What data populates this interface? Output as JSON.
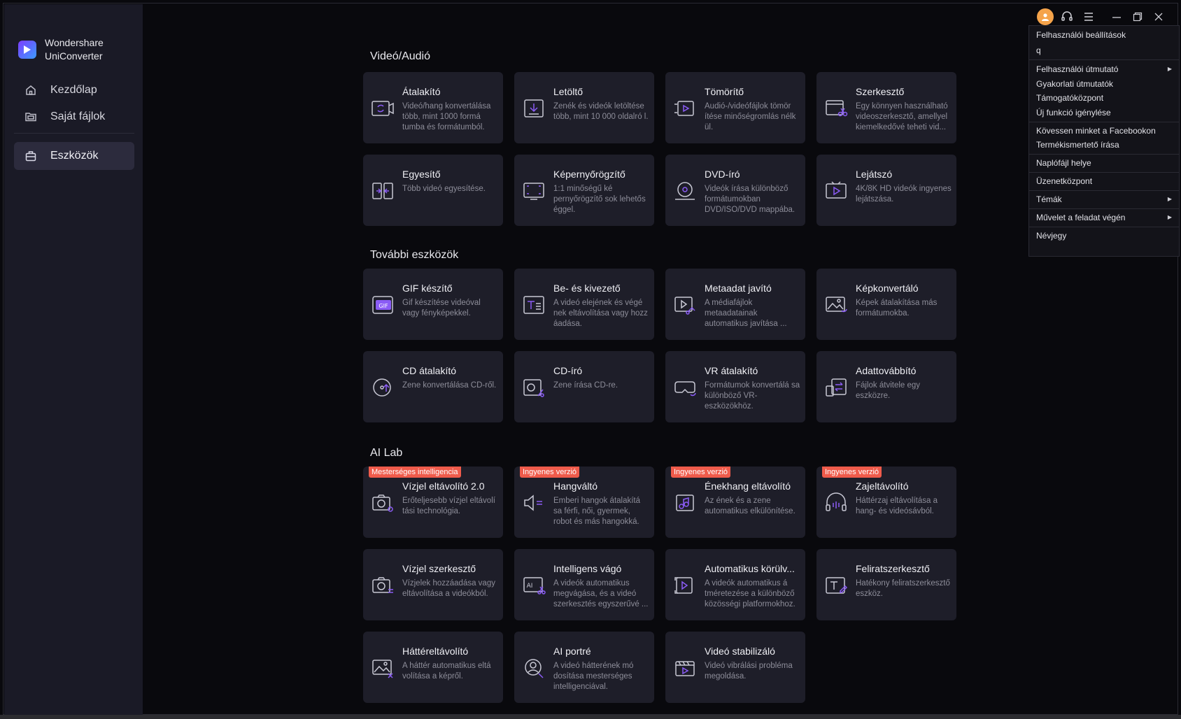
{
  "brand": {
    "line1": "Wondershare",
    "line2": "UniConverter"
  },
  "nav": {
    "home": "Kezdőlap",
    "my_files": "Saját fájlok",
    "tools": "Eszközök"
  },
  "sections": {
    "video_audio": "Videó/Audió",
    "more_tools": "További eszközök",
    "ai_lab": "AI Lab"
  },
  "cards": {
    "converter": {
      "title": "Átalakító",
      "desc": "Videó/hang konvertálása több, mint 1000 formá tumba és formátumból."
    },
    "downloader": {
      "title": "Letöltő",
      "desc": "Zenék és videók letöltése több, mint 10 000 oldalró l."
    },
    "compressor": {
      "title": "Tömörítő",
      "desc": "Audió-/videófájlok tömör ítése minőségromlás nélk ül."
    },
    "editor": {
      "title": "Szerkesztő",
      "desc": "Egy könnyen használható videoszerkesztő, amellyel kiemelkedővé teheti vid..."
    },
    "merger": {
      "title": "Egyesítő",
      "desc": "Több videó egyesítése."
    },
    "screen_recorder": {
      "title": "Képernyőrögzítő",
      "desc": "1:1 minőségű ké pernyőrögzítő sok lehetős éggel."
    },
    "dvd_burner": {
      "title": "DVD-író",
      "desc": "Videók írása különböző formátumokban DVD/ISO/DVD mappába."
    },
    "player": {
      "title": "Lejátszó",
      "desc": "4K/8K HD videók ingyenes lejátszása."
    },
    "gif_maker": {
      "title": "GIF készítő",
      "desc": "Gif készítése videóval vagy fényképekkel."
    },
    "intro_outro": {
      "title": "Be- és kivezető",
      "desc": "A videó elejének és végé nek eltávolítása vagy hozz áadása."
    },
    "metadata": {
      "title": "Metaadat javító",
      "desc": "A médiafájlok metaadatainak automatikus javítása ..."
    },
    "image_converter": {
      "title": "Képkonvertáló",
      "desc": "Képek átalakítása más formátumokba."
    },
    "cd_converter": {
      "title": "CD átalakító",
      "desc": "Zene konvertálása CD-ről."
    },
    "cd_burner": {
      "title": "CD-író",
      "desc": "Zene írása CD-re."
    },
    "vr_converter": {
      "title": "VR átalakító",
      "desc": "Formátumok konvertálá sa különböző VR-eszközökhöz."
    },
    "transfer": {
      "title": "Adattovábbító",
      "desc": "Fájlok átvitele egy eszközre."
    },
    "watermark_remover": {
      "badge": "Mesterséges intelligencia",
      "title": "Vízjel eltávolító 2.0",
      "desc": "Erőteljesebb vízjel eltávolí tási technológia."
    },
    "voice_changer": {
      "badge": "Ingyenes verzió",
      "title": "Hangváltó",
      "desc": "Emberi hangok átalakítá sa férfi, női, gyermek, robot és más hangokká."
    },
    "vocal_remover": {
      "badge": "Ingyenes verzió",
      "title": "Énekhang eltávolító",
      "desc": "Az ének és a zene automatikus elkülönítése."
    },
    "noise_remover": {
      "badge": "Ingyenes verzió",
      "title": "Zajeltávolító",
      "desc": "Háttérzaj eltávolítása a hang- és videósávból."
    },
    "watermark_editor": {
      "title": "Vízjel szerkesztő",
      "desc": "Vízjelek hozzáadása vagy eltávolítása a videókból."
    },
    "smart_trimmer": {
      "title": "Intelligens vágó",
      "desc": "A videók automatikus megvágása, és a videó szerkesztés egyszerűvé ..."
    },
    "auto_reframe": {
      "title": "Automatikus körülv...",
      "desc": "A videók automatikus á tméretezése a különböző közösségi platformokhoz."
    },
    "subtitle_editor": {
      "title": "Feliratszerkesztő",
      "desc": "Hatékony feliratszerkesztő eszköz."
    },
    "bg_remover": {
      "title": "Háttéreltávolító",
      "desc": "A háttér automatikus eltá volítása a képről."
    },
    "ai_portrait": {
      "title": "AI portré",
      "desc": "A videó hátterének mó dosítása mesterséges intelligenciával."
    },
    "stabilizer": {
      "title": "Videó stabilizáló",
      "desc": "Videó vibrálási probléma megoldása."
    }
  },
  "menu": {
    "user_settings": "Felhasználói beállítások",
    "q": "q",
    "user_guide": "Felhasználói útmutató",
    "tutorials": "Gyakorlati útmutatók",
    "support": "Támogatóközpont",
    "feature_request": "Új funkció igénylése",
    "facebook": "Kövessen minket a Facebookon",
    "review": "Termékismertető írása",
    "log_location": "Naplófájl helye",
    "message_center": "Üzenetközpont",
    "themes": "Témák",
    "after_task": "Művelet a feladat végén",
    "about": "Névjegy"
  },
  "colors": {
    "accent": "#7b3cff",
    "badge": "#ef5b4b",
    "icon_purple": "#8b5cf6"
  }
}
